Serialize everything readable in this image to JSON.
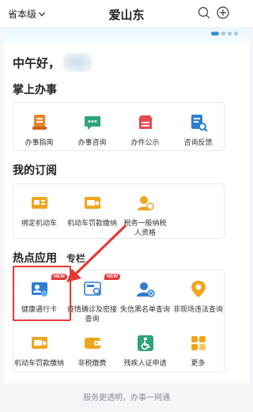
{
  "header": {
    "region_label": "省本级",
    "title": "爱山东",
    "search_icon": "search-icon",
    "add_icon": "plus-circle-icon"
  },
  "banner": {
    "indicator_active_index": 0,
    "indicator_count": 4
  },
  "greeting": {
    "text": "中午好，"
  },
  "sections": {
    "handbook": {
      "title": "掌上办事",
      "items": [
        {
          "label": "办事指南",
          "icon": "guide-document-icon",
          "color": "#e8832a"
        },
        {
          "label": "办事咨询",
          "icon": "chat-bubble-icon",
          "color": "#2fa37a"
        },
        {
          "label": "办件公示",
          "icon": "shop-board-icon",
          "color": "#e5484d"
        },
        {
          "label": "咨询反馈",
          "icon": "document-search-icon",
          "color": "#2f7dd1"
        }
      ]
    },
    "subscription": {
      "title": "我的订阅",
      "items": [
        {
          "label": "绑定机动车",
          "icon": "car-card-icon",
          "color": "#f0a51c"
        },
        {
          "label": "机动车罚款缴纳",
          "icon": "car-fine-icon",
          "color": "#f0a51c"
        },
        {
          "label": "税务一般纳税人资格",
          "icon": "taxpayer-icon",
          "color": "#f0a51c"
        }
      ]
    },
    "hot": {
      "title": "热点应用",
      "tab_special": "专栏",
      "row1": [
        {
          "label": "健康通行卡",
          "icon": "health-card-icon",
          "color": "#2f7dd1",
          "badge": "NEW"
        },
        {
          "label": "疫情确诊及密接查询",
          "icon": "epidemic-query-icon",
          "color": "#2f7dd1",
          "badge": "NEW"
        },
        {
          "label": "失信黑名单查询",
          "icon": "blacklist-icon",
          "color": "#2f7dd1"
        },
        {
          "label": "非现场违法查询",
          "icon": "location-pin-icon",
          "color": "#f0a51c"
        }
      ],
      "row2": [
        {
          "label": "机动车罚款缴纳",
          "icon": "car-fine-icon",
          "color": "#f0a51c"
        },
        {
          "label": "非税缴费",
          "icon": "wallet-icon",
          "color": "#f0a51c"
        },
        {
          "label": "残疾人证申请",
          "icon": "disabled-card-icon",
          "color": "#2fa37a"
        },
        {
          "label": "更多",
          "icon": "grid-more-icon",
          "color": "#f0a51c"
        }
      ]
    }
  },
  "footer": {
    "text": "服务更透明，办事一网通"
  },
  "colors": {
    "accent": "#2f7dd1",
    "annotation_red": "#e53935"
  }
}
